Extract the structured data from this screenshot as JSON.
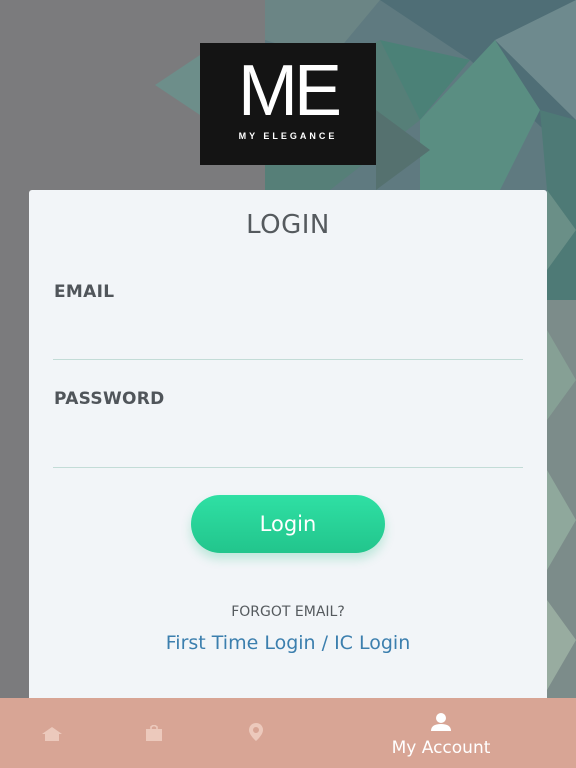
{
  "logo": {
    "main_text": "ME",
    "sub_text": "MY ELEGANCE"
  },
  "login_card": {
    "title": "LOGIN",
    "email_label": "EMAIL",
    "email_value": "",
    "password_label": "PASSWORD",
    "password_value": "",
    "login_button": "Login",
    "forgot_email": "FORGOT EMAIL?",
    "first_time_login": "First Time Login / IC Login"
  },
  "bottom_nav": {
    "items": [
      {
        "icon": "home-icon",
        "label": ""
      },
      {
        "icon": "shopping-bag-icon",
        "label": ""
      },
      {
        "icon": "location-pin-icon",
        "label": ""
      },
      {
        "icon": "user-icon",
        "label": "My Account"
      }
    ]
  },
  "colors": {
    "background": "#7b7b7d",
    "card": "#f2f5f8",
    "accent_green": "#2cd49a",
    "link_blue": "#3c7fae",
    "bottom_bar": "#d8a595"
  }
}
